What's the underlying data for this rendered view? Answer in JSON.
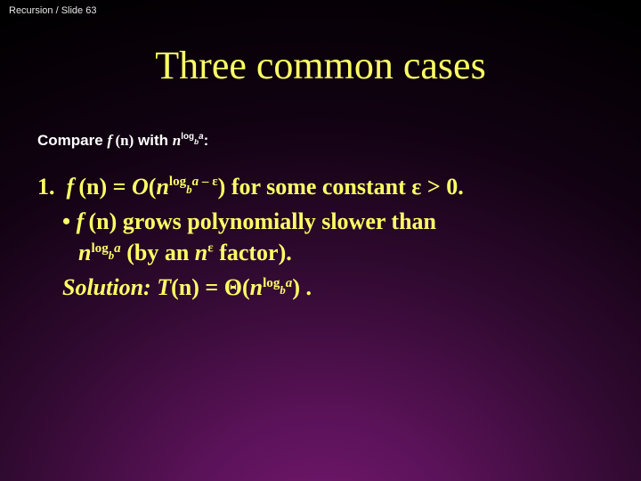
{
  "header": {
    "text": "Recursion / Slide 63"
  },
  "title": "Three common cases",
  "compare": {
    "prefix": "Compare ",
    "f": "f ",
    "paren_n": "(n)",
    "with": " with ",
    "n": "n",
    "log": "log",
    "b": "b",
    "a": "a",
    "colon": ":"
  },
  "case1": {
    "num": "1.",
    "f": "f ",
    "paren_n": "(n)",
    "eq": " = ",
    "O": "O",
    "open": "(",
    "n": "n",
    "log": "log",
    "b": "b",
    "a": "a",
    "minus": " – ",
    "eps": "ε",
    "close": ")",
    "tail": " for some constant ",
    "eps2": "ε",
    "gt0": " > 0."
  },
  "bullet": {
    "dot": "• ",
    "f": "f ",
    "paren_n": "(n)",
    "txt1": " grows polynomially slower than ",
    "n": "n",
    "log": "log",
    "b": "b",
    "a": "a",
    "txt2": " (by an ",
    "n2": "n",
    "eps": "ε",
    "txt3": " factor)."
  },
  "solution": {
    "label": "Solution:",
    "sp": " ",
    "T": "T",
    "paren_n": "(n)",
    "eq": " = ",
    "theta": "Θ",
    "open": "(",
    "n": "n",
    "log": "log",
    "b": "b",
    "a": "a",
    "close": ")",
    "dot": " ."
  }
}
